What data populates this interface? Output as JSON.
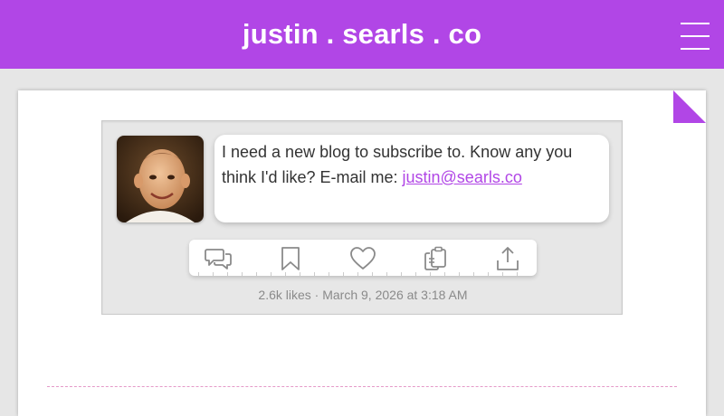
{
  "header": {
    "site_title": "justin . searls . co",
    "background": "#b146e6",
    "menu_icon": "hamburger-menu-icon"
  },
  "post": {
    "text": "I need a new blog to subscribe to. Know any you think I'd like? E-mail me: ",
    "email": "justin@searls.co",
    "likes": "2.6k likes",
    "separator": " · ",
    "date": "March 9, 2026 at 3:18 AM",
    "avatar_icon": "author-avatar",
    "link_color": "#b146e6"
  },
  "actions": [
    {
      "name": "reply-button",
      "icon": "speech-bubbles-icon"
    },
    {
      "name": "bookmark-button",
      "icon": "bookmark-icon"
    },
    {
      "name": "like-button",
      "icon": "heart-icon"
    },
    {
      "name": "copy-button",
      "icon": "clipboard-copy-icon"
    },
    {
      "name": "share-button",
      "icon": "share-upload-icon"
    }
  ]
}
